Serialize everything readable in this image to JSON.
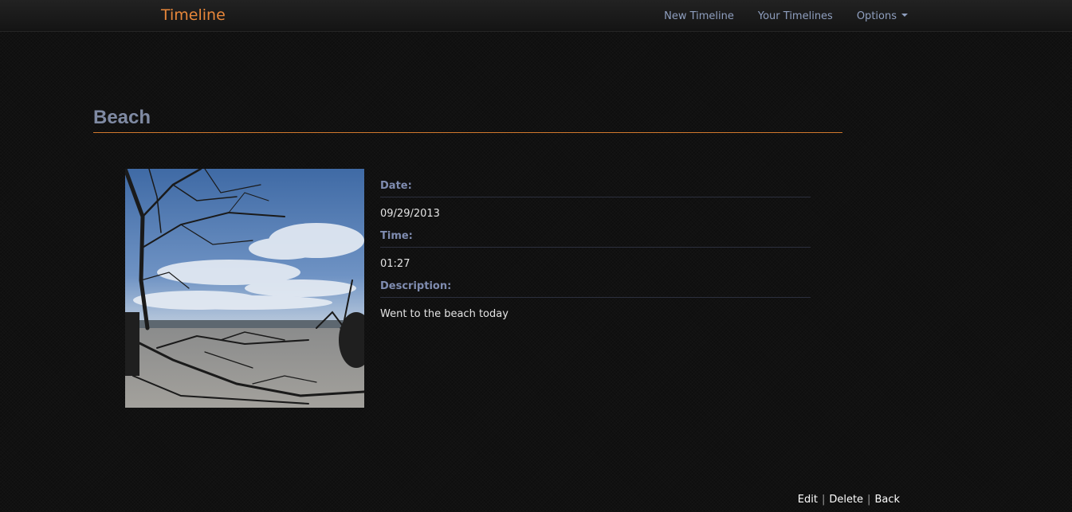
{
  "nav": {
    "brand": "Timeline",
    "items": [
      {
        "label": "New Timeline"
      },
      {
        "label": "Your Timelines"
      },
      {
        "label": "Options"
      }
    ]
  },
  "entry": {
    "title": "Beach",
    "fields": [
      {
        "label": "Date:",
        "value": "09/29/2013"
      },
      {
        "label": "Time:",
        "value": "01:27"
      },
      {
        "label": "Description:",
        "value": "Went to the beach today"
      }
    ]
  },
  "actions": {
    "edit": "Edit",
    "delete": "Delete",
    "back": "Back",
    "separator": "|"
  },
  "icons": {
    "options_dropdown": "caret-down-icon"
  },
  "colors": {
    "brand": "#e8873a",
    "nav_text": "#8f9fbf",
    "title": "#7f8aa3",
    "title_rule": "#d1782d",
    "field_label": "#7f8cb0",
    "background": "#111111"
  }
}
